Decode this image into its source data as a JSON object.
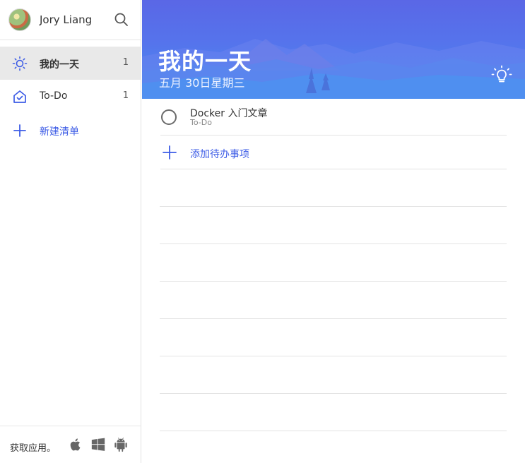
{
  "user": {
    "name": "Jory Liang",
    "avatar_icon": "avatar-image"
  },
  "sidebar": {
    "search_icon": "search-icon",
    "items": [
      {
        "label": "我的一天",
        "count": "1",
        "icon": "sun-icon",
        "active": true
      },
      {
        "label": "To-Do",
        "count": "1",
        "icon": "home-check-icon",
        "active": false
      }
    ],
    "new_list_label": "新建清单",
    "footer": {
      "get_apps_label": "获取应用。",
      "platforms": [
        "apple-icon",
        "windows-icon",
        "android-icon"
      ]
    }
  },
  "main": {
    "title": "我的一天",
    "date": "五月 30日星期三",
    "suggestions_icon": "lightbulb-icon",
    "tasks": [
      {
        "title": "Docker 入门文章",
        "list": "To-Do",
        "completed": false
      }
    ],
    "add_task_label": "添加待办事项"
  },
  "colors": {
    "accent": "#3d5ce6",
    "banner_top": "#5a67e6",
    "banner_bottom": "#4c90f0",
    "active_item_bg": "#e9e9e9"
  }
}
